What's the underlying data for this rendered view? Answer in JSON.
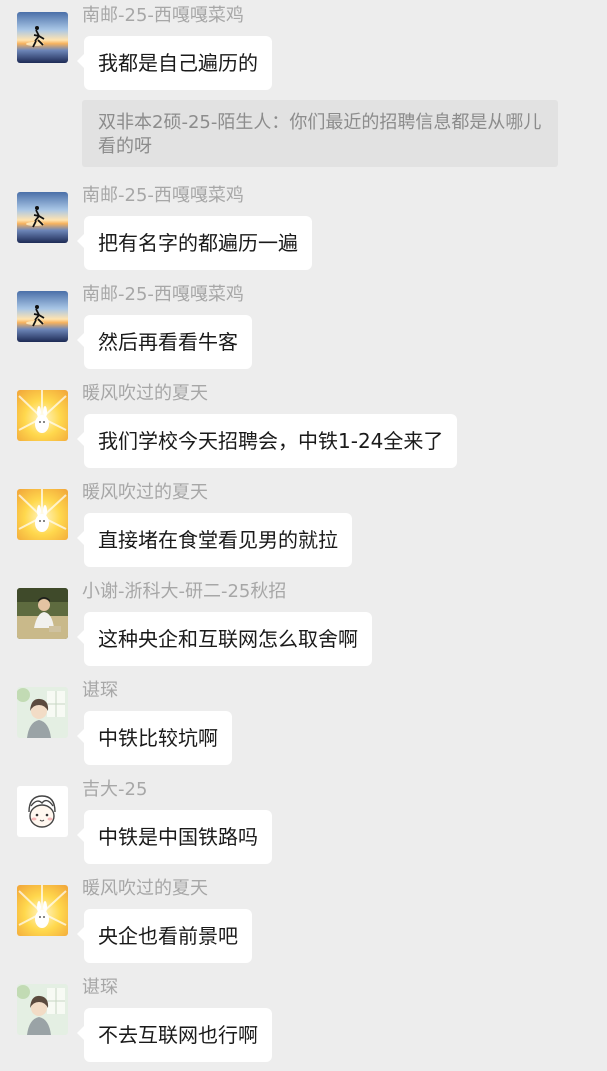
{
  "messages": [
    {
      "avatar": "runner-sunset-avatar",
      "sender": "南邮-25-西嘎嘎菜鸡",
      "text": "我都是自己遍历的"
    },
    {
      "avatar": "runner-sunset-avatar",
      "sender": "南邮-25-西嘎嘎菜鸡",
      "text": "把有名字的都遍历一遍"
    },
    {
      "avatar": "runner-sunset-avatar",
      "sender": "南邮-25-西嘎嘎菜鸡",
      "text": "然后再看看牛客"
    },
    {
      "avatar": "bunny-rays-avatar",
      "sender": "暖风吹过的夏天",
      "text": "我们学校今天招聘会，中铁1-24全来了"
    },
    {
      "avatar": "bunny-rays-avatar",
      "sender": "暖风吹过的夏天",
      "text": "直接堵在食堂看见男的就拉"
    },
    {
      "avatar": "person-photo-avatar",
      "sender": "小谢-浙科大-研二-25秋招",
      "text": "这种央企和互联网怎么取舍啊"
    },
    {
      "avatar": "anime-boy-avatar",
      "sender": "谌琛",
      "text": "中铁比较坑啊"
    },
    {
      "avatar": "cartoon-face-avatar",
      "sender": "吉大-25",
      "text": "中铁是中国铁路吗"
    },
    {
      "avatar": "bunny-rays-avatar",
      "sender": "暖风吹过的夏天",
      "text": "央企也看前景吧"
    },
    {
      "avatar": "anime-boy-avatar",
      "sender": "谌琛",
      "text": "不去互联网也行啊"
    }
  ],
  "quote": {
    "sender": "双非本2硕-25-陌生人",
    "separator": "：",
    "text": "你们最近的招聘信息都是从哪儿看的呀"
  }
}
